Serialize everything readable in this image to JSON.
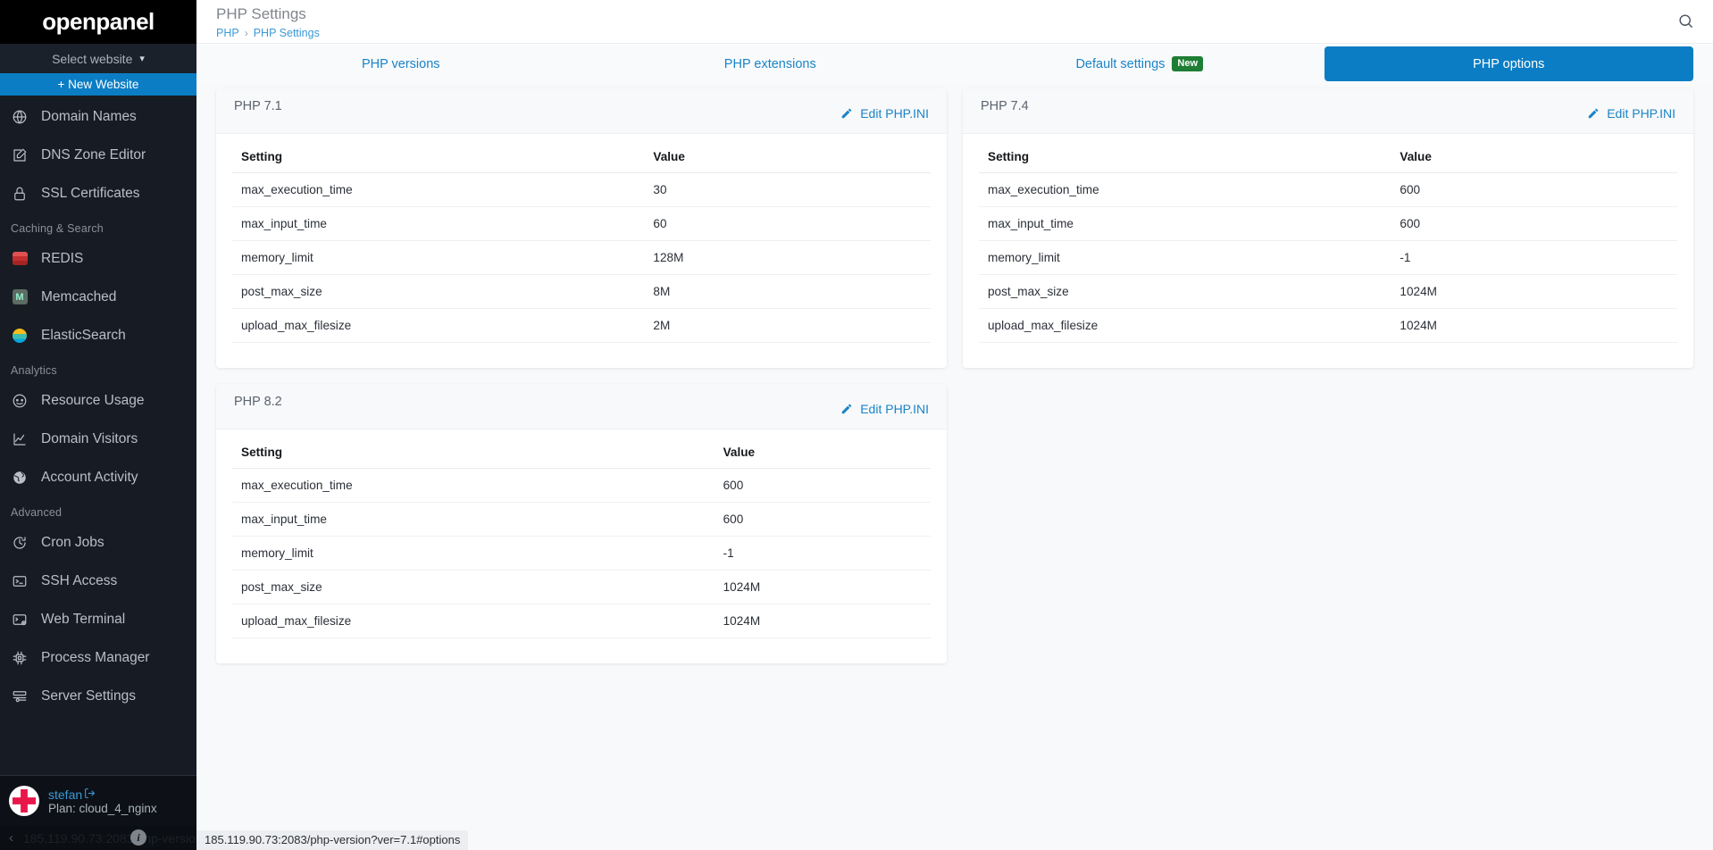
{
  "sidebar": {
    "brand": "openpanel",
    "site_selector": {
      "label": "Select website",
      "icon": "chevron-down-icon"
    },
    "new_website_button": "+ New Website",
    "items": [
      {
        "label": "Domain Names",
        "icon": "globe-icon",
        "type": "link"
      },
      {
        "label": "DNS Zone Editor",
        "icon": "edit-square-icon",
        "type": "link"
      },
      {
        "label": "SSL Certificates",
        "icon": "lock-icon",
        "type": "link"
      },
      {
        "label": "Caching & Search",
        "type": "section"
      },
      {
        "label": "REDIS",
        "icon": "redis-icon",
        "type": "link"
      },
      {
        "label": "Memcached",
        "icon": "memcached-icon",
        "type": "link"
      },
      {
        "label": "ElasticSearch",
        "icon": "elasticsearch-icon",
        "type": "link"
      },
      {
        "label": "Analytics",
        "type": "section"
      },
      {
        "label": "Resource Usage",
        "icon": "gauge-icon",
        "type": "link"
      },
      {
        "label": "Domain Visitors",
        "icon": "line-chart-icon",
        "type": "link"
      },
      {
        "label": "Account Activity",
        "icon": "globe-activity-icon",
        "type": "link"
      },
      {
        "label": "Advanced",
        "type": "section"
      },
      {
        "label": "Cron Jobs",
        "icon": "clock-icon",
        "type": "link"
      },
      {
        "label": "SSH Access",
        "icon": "terminal-icon",
        "type": "link"
      },
      {
        "label": "Web Terminal",
        "icon": "web-terminal-icon",
        "type": "link"
      },
      {
        "label": "Process Manager",
        "icon": "cpu-icon",
        "type": "link"
      },
      {
        "label": "Server Settings",
        "icon": "server-icon",
        "type": "link"
      }
    ],
    "user": {
      "name": "stefan",
      "logout_icon": "logout-icon",
      "plan": "Plan: cloud_4_nginx"
    },
    "status": {
      "collapse_icon": "chevron-left-icon",
      "info_icon": "info-icon",
      "url": "185.119.90.73:2083/php-version?ver=7.1#options"
    }
  },
  "header": {
    "title": "PHP Settings",
    "breadcrumb": {
      "root": "PHP",
      "separator": "›",
      "current": "PHP Settings"
    },
    "search_icon": "search-icon"
  },
  "tabs": [
    {
      "label": "PHP versions",
      "active": false,
      "badge": null
    },
    {
      "label": "PHP extensions",
      "active": false,
      "badge": null
    },
    {
      "label": "Default settings",
      "active": false,
      "badge": "New"
    },
    {
      "label": "PHP options",
      "active": true,
      "badge": null
    }
  ],
  "colors": {
    "accent": "#0b7dc4",
    "link": "#1a84c7",
    "badge_new": "#1e7e34",
    "sidebar": "#171c24"
  },
  "cards": [
    {
      "title": "PHP 7.1",
      "edit_label": "Edit PHP.INI",
      "edit_icon": "pencil-icon",
      "columns": [
        "Setting",
        "Value"
      ],
      "rows": [
        [
          "max_execution_time",
          "30"
        ],
        [
          "max_input_time",
          "60"
        ],
        [
          "memory_limit",
          "128M"
        ],
        [
          "post_max_size",
          "8M"
        ],
        [
          "upload_max_filesize",
          "2M"
        ]
      ]
    },
    {
      "title": "PHP 7.4",
      "edit_label": "Edit PHP.INI",
      "edit_icon": "pencil-icon",
      "columns": [
        "Setting",
        "Value"
      ],
      "rows": [
        [
          "max_execution_time",
          "600"
        ],
        [
          "max_input_time",
          "600"
        ],
        [
          "memory_limit",
          "-1"
        ],
        [
          "post_max_size",
          "1024M"
        ],
        [
          "upload_max_filesize",
          "1024M"
        ]
      ]
    },
    {
      "title": "PHP 8.2",
      "edit_label": "Edit PHP.INI",
      "edit_icon": "pencil-icon",
      "columns": [
        "Setting",
        "Value"
      ],
      "rows": [
        [
          "max_execution_time",
          "600"
        ],
        [
          "max_input_time",
          "600"
        ],
        [
          "memory_limit",
          "-1"
        ],
        [
          "post_max_size",
          "1024M"
        ],
        [
          "upload_max_filesize",
          "1024M"
        ]
      ]
    }
  ]
}
